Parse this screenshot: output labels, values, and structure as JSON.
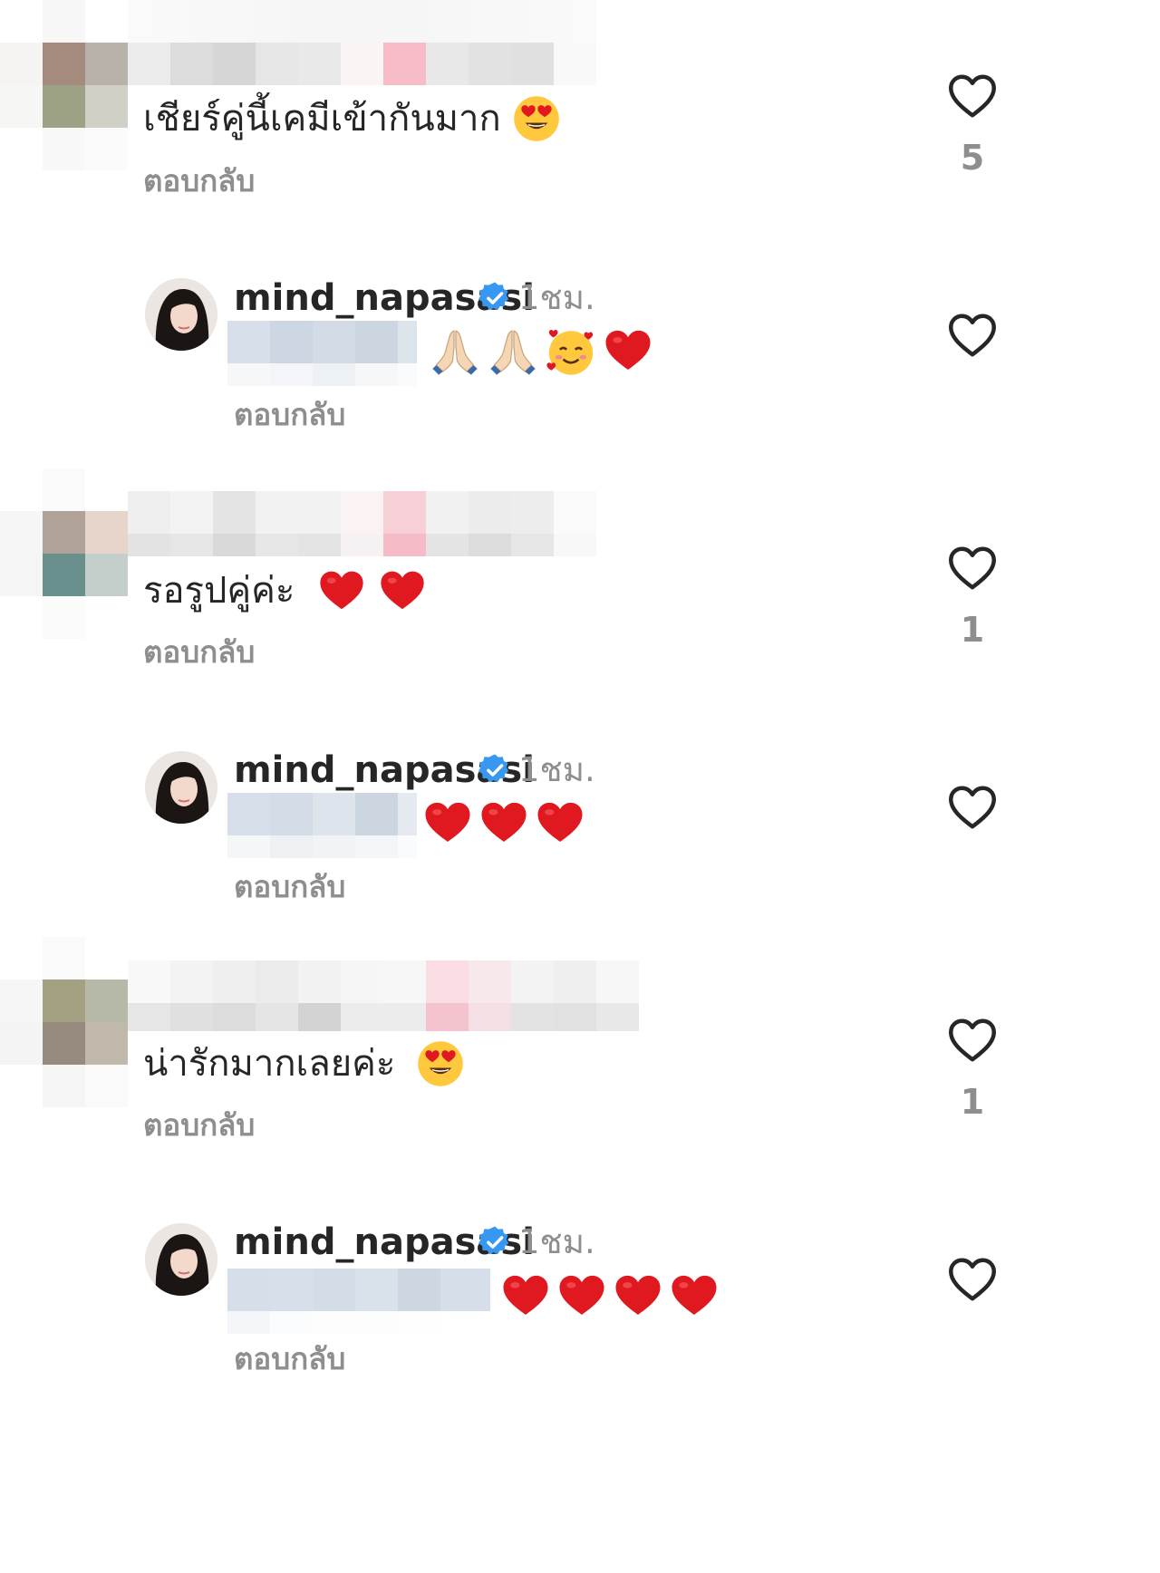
{
  "comments": [
    {
      "text": "เชียร์คู่นี้เคมีเข้ากันมาก",
      "reply_label": "ตอบกลับ",
      "like_count": "5"
    },
    {
      "text": "รอรูปคู่ค่ะ",
      "reply_label": "ตอบกลับ",
      "like_count": "1"
    },
    {
      "text": "น่ารักมากเลยค่ะ",
      "reply_label": "ตอบกลับ",
      "like_count": "1"
    }
  ],
  "replies": [
    {
      "username": "mind_napasasi",
      "time": "1ชม.",
      "reply_label": "ตอบกลับ",
      "emoji": "pray-pray-smiling-hearts-heart"
    },
    {
      "username": "mind_napasasi",
      "time": "1ชม.",
      "reply_label": "ตอบกลับ",
      "emoji": "heart-x3"
    },
    {
      "username": "mind_napasasi",
      "time": "1ชม.",
      "reply_label": "ตอบกลับ",
      "emoji": "heart-x4"
    }
  ],
  "colors": {
    "text": "#262626",
    "secondary": "#8e8e8e",
    "verified": "#3897f0",
    "heart_emoji": "#e0181f"
  },
  "icons": {
    "like": "heart-outline-icon",
    "verified": "verified-badge-icon"
  }
}
